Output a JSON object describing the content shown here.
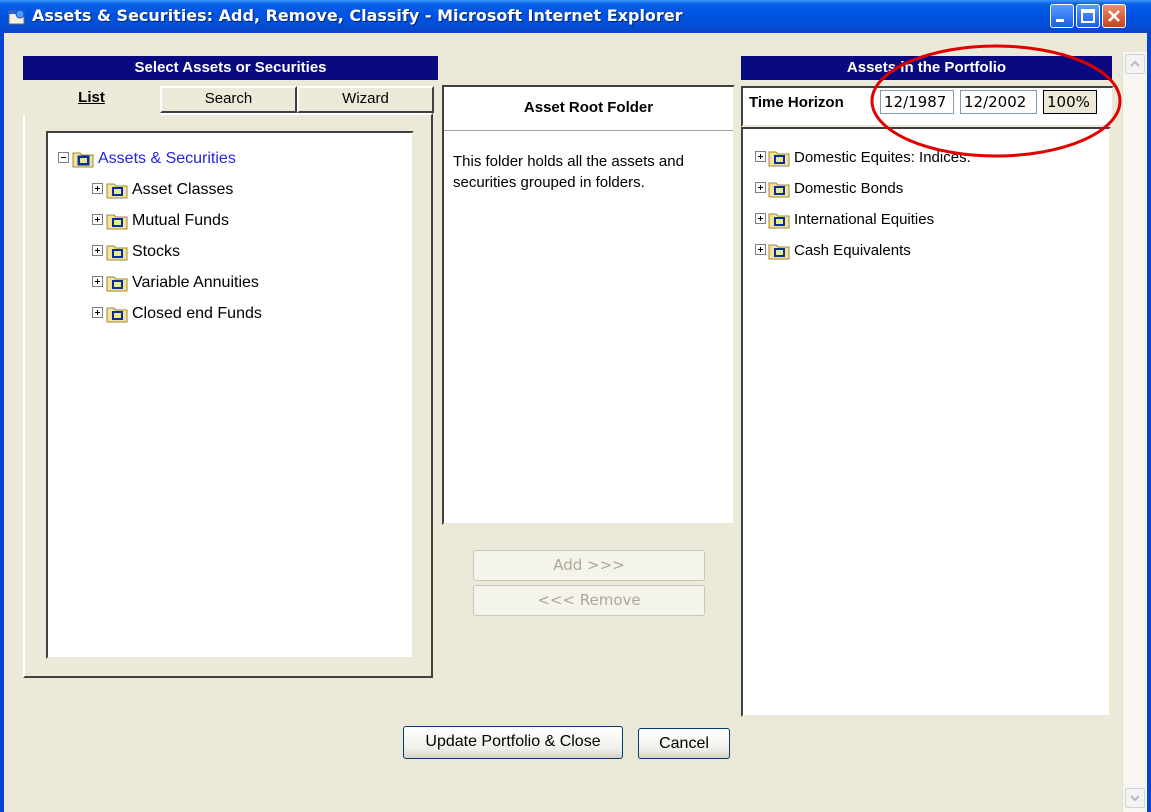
{
  "window": {
    "title": "Assets & Securities: Add, Remove, Classify - Microsoft Internet Explorer"
  },
  "left_panel": {
    "header": "Select Assets or Securities",
    "tabs": [
      {
        "label": "List",
        "active": true
      },
      {
        "label": "Search",
        "active": false
      },
      {
        "label": "Wizard",
        "active": false
      }
    ],
    "tree": {
      "root": {
        "label": "Assets & Securities",
        "expanded": true
      },
      "children": [
        {
          "label": "Asset Classes"
        },
        {
          "label": "Mutual Funds"
        },
        {
          "label": "Stocks"
        },
        {
          "label": "Variable Annuities"
        },
        {
          "label": "Closed end Funds"
        }
      ]
    }
  },
  "middle_panel": {
    "title": "Asset Root Folder",
    "description": "This folder holds all the assets and securities grouped in folders.",
    "add_button": "Add >>>",
    "remove_button": "<<< Remove"
  },
  "right_panel": {
    "header": "Assets in the Portfolio",
    "time_horizon_label": "Time Horizon",
    "start_date": "12/1987",
    "end_date": "12/2002",
    "percent": "100%",
    "tree": [
      {
        "label": "Domestic Equites: Indices."
      },
      {
        "label": "Domestic Bonds"
      },
      {
        "label": "International Equities"
      },
      {
        "label": "Cash Equivalents"
      }
    ]
  },
  "footer": {
    "update_button": "Update Portfolio & Close",
    "cancel_button": "Cancel"
  },
  "colors": {
    "title_bar": "#0054e3",
    "section_header": "#0a0a80",
    "dialog_bg": "#ece9d8",
    "link_blue": "#2424e0",
    "annotation_circle": "#e00000"
  },
  "icons": {
    "app": "ie-window-icon",
    "folder": "folder-with-s-icon",
    "expander_plus": "plus-box-icon",
    "expander_minus": "minus-box-icon"
  }
}
